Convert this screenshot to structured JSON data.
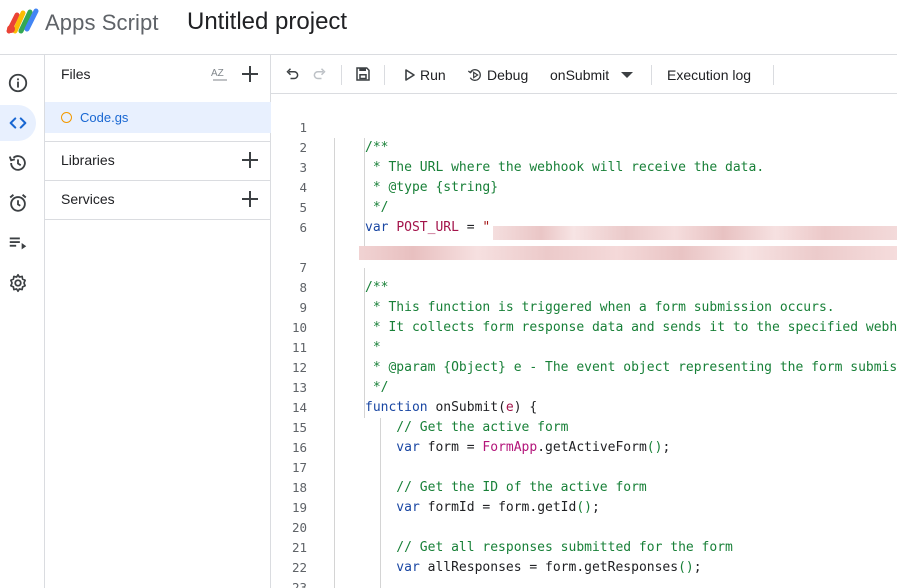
{
  "header": {
    "brand": "Apps Script",
    "project_title": "Untitled project"
  },
  "rail": {
    "items": [
      {
        "name": "overview",
        "icon": "info-icon"
      },
      {
        "name": "editor",
        "icon": "code-icon",
        "active": true
      },
      {
        "name": "executions",
        "icon": "history-icon"
      },
      {
        "name": "triggers",
        "icon": "alarm-icon"
      },
      {
        "name": "executions-list",
        "icon": "playlist-play-icon"
      },
      {
        "name": "settings",
        "icon": "gear-icon"
      }
    ]
  },
  "files_panel": {
    "files_label": "Files",
    "sort_label": "AZ",
    "file_name": "Code.gs",
    "libraries_label": "Libraries",
    "services_label": "Services"
  },
  "toolbar": {
    "run_label": "Run",
    "debug_label": "Debug",
    "function_selected": "onSubmit",
    "execution_log_label": "Execution log"
  },
  "colors": {
    "accent": "#1967d2",
    "active_bg": "#e8f0fe",
    "comment": "#188038",
    "keyword": "#1a47a3",
    "string": "#a31515",
    "class": "#b3157a"
  },
  "editor": {
    "lines": [
      {
        "n": "1",
        "tokens": []
      },
      {
        "n": "2",
        "tokens": [
          {
            "t": "/**",
            "c": "c-comment"
          }
        ]
      },
      {
        "n": "3",
        "tokens": [
          {
            "t": " * The URL where the webhook will receive the data.",
            "c": "c-comment"
          }
        ]
      },
      {
        "n": "4",
        "tokens": [
          {
            "t": " * @type {string}",
            "c": "c-comment"
          }
        ]
      },
      {
        "n": "5",
        "tokens": [
          {
            "t": " */",
            "c": "c-comment"
          }
        ]
      },
      {
        "n": "6",
        "tokens": [
          {
            "t": "var ",
            "c": "c-kw"
          },
          {
            "t": "POST_URL",
            "c": "c-var"
          },
          {
            "t": " = ",
            "c": "c-fn"
          },
          {
            "t": "\"",
            "c": "c-str"
          }
        ]
      },
      {
        "n": "",
        "tokens": []
      },
      {
        "n": "7",
        "tokens": []
      },
      {
        "n": "8",
        "tokens": [
          {
            "t": "/**",
            "c": "c-comment"
          }
        ]
      },
      {
        "n": "9",
        "tokens": [
          {
            "t": " * This function is triggered when a form submission occurs.",
            "c": "c-comment"
          }
        ]
      },
      {
        "n": "10",
        "tokens": [
          {
            "t": " * It collects form response data and sends it to the specified webhook.",
            "c": "c-comment"
          }
        ]
      },
      {
        "n": "11",
        "tokens": [
          {
            "t": " *",
            "c": "c-comment"
          }
        ]
      },
      {
        "n": "12",
        "tokens": [
          {
            "t": " * @param {Object} e - The event object representing the form submission.",
            "c": "c-comment"
          }
        ]
      },
      {
        "n": "13",
        "tokens": [
          {
            "t": " */",
            "c": "c-comment"
          }
        ]
      },
      {
        "n": "14",
        "tokens": [
          {
            "t": "function ",
            "c": "c-kw"
          },
          {
            "t": "onSubmit(",
            "c": "c-fn"
          },
          {
            "t": "e",
            "c": "c-var"
          },
          {
            "t": ") {",
            "c": "c-fn"
          }
        ]
      },
      {
        "n": "15",
        "tokens": [
          {
            "t": "    // Get the active form",
            "c": "c-comment"
          }
        ]
      },
      {
        "n": "16",
        "tokens": [
          {
            "t": "    var ",
            "c": "c-kw"
          },
          {
            "t": "form = ",
            "c": "c-fn"
          },
          {
            "t": "FormApp",
            "c": "c-cls"
          },
          {
            "t": ".getActiveForm",
            "c": "c-fn"
          },
          {
            "t": "()",
            "c": "c-comment"
          },
          {
            "t": ";",
            "c": "c-fn"
          }
        ]
      },
      {
        "n": "17",
        "tokens": []
      },
      {
        "n": "18",
        "tokens": [
          {
            "t": "    // Get the ID of the active form",
            "c": "c-comment"
          }
        ]
      },
      {
        "n": "19",
        "tokens": [
          {
            "t": "    var ",
            "c": "c-kw"
          },
          {
            "t": "formId = form.getId",
            "c": "c-fn"
          },
          {
            "t": "()",
            "c": "c-comment"
          },
          {
            "t": ";",
            "c": "c-fn"
          }
        ]
      },
      {
        "n": "20",
        "tokens": []
      },
      {
        "n": "21",
        "tokens": [
          {
            "t": "    // Get all responses submitted for the form",
            "c": "c-comment"
          }
        ]
      },
      {
        "n": "22",
        "tokens": [
          {
            "t": "    var ",
            "c": "c-kw"
          },
          {
            "t": "allResponses = form.getResponses",
            "c": "c-fn"
          },
          {
            "t": "()",
            "c": "c-comment"
          },
          {
            "t": ";",
            "c": "c-fn"
          }
        ]
      },
      {
        "n": "23",
        "tokens": []
      }
    ]
  }
}
